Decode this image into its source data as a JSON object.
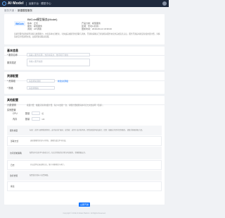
{
  "topbar": {
    "logo": "AI·Model",
    "subtitle": "运营平台 · 模型中心"
  },
  "breadcrumb": {
    "parent": "服务开通",
    "current": "新建模型服务"
  },
  "product": {
    "logo_text": "BitCoin",
    "name": "BitCoin模型服务(Model)",
    "version_label": "版本：正式",
    "type_label": "产品分类：模型服务",
    "creator_label": "服务：模型服务",
    "area_label": "区域：华北1(北京)",
    "cycle_label": "调用：API调用",
    "time_label": "更新时间：2019-06-12 10:30:20",
    "description": "该模型服务提供模型训练与推理能力，支持多种主流框架，可快速完成模型的部署与调用。开通前请确认已阅读相关服务协议并完成实名认证，服务开通后将按实际使用量计费，详情请参见计费说明文档。如需帮助请联系客服。"
  },
  "basic": {
    "title": "基本信息",
    "name_label": "* 服务名称",
    "name_placeholder": "请输入服务名称，支持中英文、数字和下划线",
    "desc_label": "服务描述",
    "desc_placeholder": "请输入服务描述"
  },
  "resource": {
    "title": "资源配置",
    "group_label": "* 资源组",
    "group_placeholder": "请选择资源组",
    "group_link": "新建资源组",
    "spec_label": "* 规格",
    "spec_placeholder": "请选择规格"
  },
  "options": {
    "title": "其他配置",
    "hint_label": "计费说明",
    "hint_text": "按量计费：根据实际调用量计费，每小时出账一次，详细计费规则请参考官方文档说明（链接）。",
    "section_label": "实例配置",
    "cpu_label": "CPU",
    "cpu_field_label": "数量",
    "cpu_unit": "核",
    "mem_label": "内存",
    "mem_field_label": "数量",
    "mem_unit": "GB",
    "rows": [
      {
        "key": "服务类型",
        "value": "标准：适用于通用推理场景，支持自动扩缩容；高性能：适用于高并发场景，提供更低的响应延迟；定制：根据业务需求定制服务，请联系客服获取方案。"
      },
      {
        "key": "部署方式",
        "value": "选择部署的区域与可用区，部署完成后不可修改。"
      },
      {
        "key": "访问控制策略",
        "value": "配置访问白名单与鉴权方式，仅允许授权的应用访问该服务，保障数据安全。"
      },
      {
        "key": "日志",
        "value": "开启后将记录调用日志，便于问题排查与审计。"
      },
      {
        "key": "监控告警",
        "value": "配置监控指标与告警阈值。"
      },
      {
        "key": "备注",
        "value": ""
      }
    ]
  },
  "submit_label": "立即开通",
  "footer": "Copyright © 2019 AI Model Platform. All Rights Reserved."
}
